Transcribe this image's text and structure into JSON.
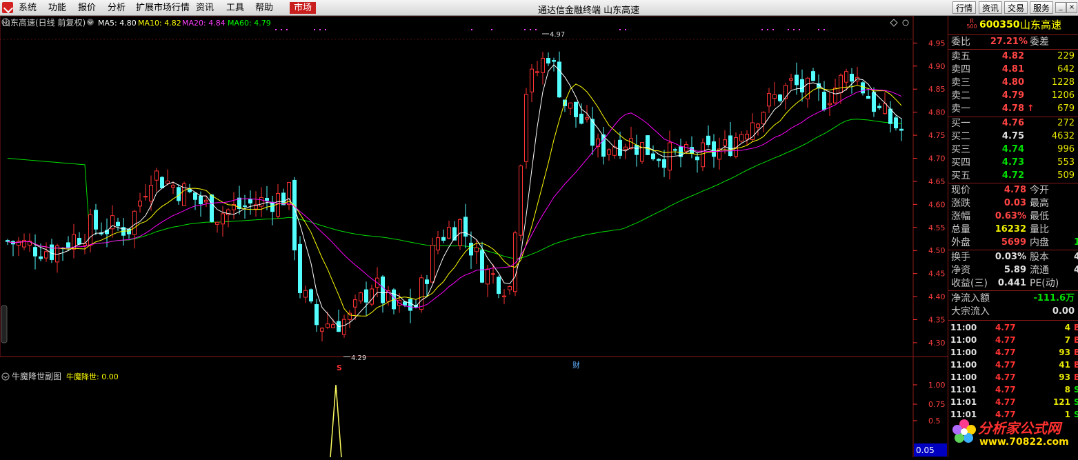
{
  "menu": {
    "items": [
      "系统",
      "功能",
      "报价",
      "分析",
      "扩展市场行情",
      "资讯",
      "工具",
      "帮助"
    ],
    "active": "市场",
    "title": "通达信金融终端  山东高速",
    "right_buttons": [
      "行情",
      "资讯",
      "交易",
      "服务"
    ]
  },
  "chart": {
    "info_title": "山东高速(日线 前复权)",
    "ma": [
      {
        "label": "MA5: 4.80",
        "color": "#ffffff"
      },
      {
        "label": "MA10: 4.82",
        "color": "#ffff00"
      },
      {
        "label": "MA20: 4.84",
        "color": "#ff00ff"
      },
      {
        "label": "MA60: 4.79",
        "color": "#00ff00"
      }
    ],
    "price_axis": [
      "4.95",
      "4.90",
      "4.85",
      "4.80",
      "4.75",
      "4.70",
      "4.65",
      "4.60",
      "4.55",
      "4.50",
      "4.45",
      "4.40",
      "4.35",
      "4.30"
    ],
    "price_min": 4.27,
    "price_max": 4.97,
    "high_label": "4.97",
    "low_label": "4.29",
    "marker_s": "S",
    "marker_cai": "财",
    "colors": {
      "up": "#ff3232",
      "down": "#54ffff",
      "ma5": "#ffffff",
      "ma10": "#ffff00",
      "ma20": "#ff00ff",
      "ma60": "#00e000"
    },
    "sub_title": "牛魔降世副图",
    "sub_value": "牛魔降世: 0.00",
    "sub_axis": [
      "1.00",
      "0.75",
      "0.5"
    ],
    "sub_box": "0.05"
  },
  "quote": {
    "code_prefix": "R\n500",
    "code": "600350",
    "name": "山东高速",
    "weibi_label": "委比",
    "weibi_value": "27.21%",
    "weicha_label": "委差",
    "sell": [
      {
        "label": "卖五",
        "price": "4.82",
        "vol": "229"
      },
      {
        "label": "卖四",
        "price": "4.81",
        "vol": "642"
      },
      {
        "label": "卖三",
        "price": "4.80",
        "vol": "1228"
      },
      {
        "label": "卖二",
        "price": "4.79",
        "vol": "1206"
      },
      {
        "label": "卖一",
        "price": "4.78",
        "vol": "679",
        "arrow": "↑"
      }
    ],
    "buy": [
      {
        "label": "买一",
        "price": "4.76",
        "vol": "272"
      },
      {
        "label": "买二",
        "price": "4.75",
        "vol": "4632"
      },
      {
        "label": "买三",
        "price": "4.74",
        "vol": "996"
      },
      {
        "label": "买四",
        "price": "4.73",
        "vol": "553"
      },
      {
        "label": "买五",
        "price": "4.72",
        "vol": "509"
      }
    ],
    "stats1": [
      {
        "l": "现价",
        "v": "4.78",
        "r": "今开",
        "c": "red"
      },
      {
        "l": "涨跌",
        "v": "0.03",
        "r": "最高",
        "c": "red"
      },
      {
        "l": "涨幅",
        "v": "0.63%",
        "r": "最低",
        "c": "red"
      },
      {
        "l": "总量",
        "v": "16232",
        "r": "量比",
        "c": "yellow"
      },
      {
        "l": "外盘",
        "v": "5699",
        "r": "内盘",
        "c": "red",
        "r2": "1"
      }
    ],
    "stats2": [
      {
        "l": "换手",
        "v": "0.03%",
        "r": "股本",
        "r2": "4"
      },
      {
        "l": "净资",
        "v": "5.89",
        "r": "流通",
        "r2": "4"
      },
      {
        "l": "收益(三)",
        "v": "0.441",
        "r": "PE(动)",
        "r2": ""
      }
    ],
    "netflow_label": "净流入额",
    "netflow_value": "-111.6万",
    "bigflow_label": "大宗流入",
    "bigflow_value": "0.00",
    "ticks": [
      {
        "t": "11:00",
        "p": "4.77",
        "v": "4",
        "s": "B"
      },
      {
        "t": "11:00",
        "p": "4.77",
        "v": "7",
        "s": "B"
      },
      {
        "t": "11:00",
        "p": "4.77",
        "v": "93",
        "s": "B"
      },
      {
        "t": "11:00",
        "p": "4.77",
        "v": "41",
        "s": "B"
      },
      {
        "t": "11:00",
        "p": "4.77",
        "v": "93",
        "s": "B"
      },
      {
        "t": "11:01",
        "p": "4.77",
        "v": "8",
        "s": "S"
      },
      {
        "t": "11:01",
        "p": "4.77",
        "v": "121",
        "s": "S"
      },
      {
        "t": "11:01",
        "p": "4.77",
        "v": "1",
        "s": "S"
      }
    ]
  },
  "watermark": {
    "name": "分析家公式网",
    "url": "www.70822.com"
  }
}
